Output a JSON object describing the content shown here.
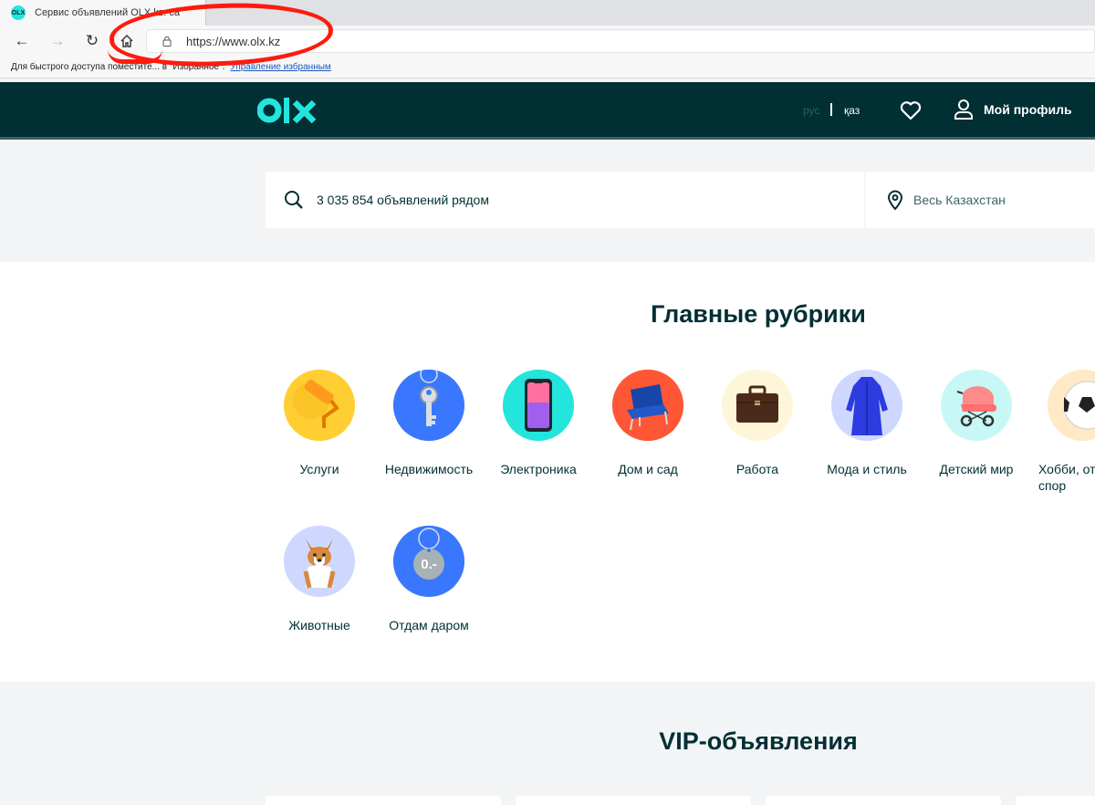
{
  "browser": {
    "tab_title": "Сервис объявлений OLX.kz: са",
    "favicon_text": "OLX",
    "url": "https://www.olx.kz",
    "favorites_bar_text": "Для быстрого доступа поместите... в \"Избранное\".",
    "favorites_manage_link": "Управление избранным"
  },
  "header": {
    "logo": "olx",
    "lang_ru": "рус",
    "lang_kz": "қаз",
    "profile_label": "Мой профиль",
    "colors": {
      "header_bg": "#002f34",
      "accent": "#23e5db"
    }
  },
  "search": {
    "placeholder": "3 035 854 объявлений рядом",
    "location": "Весь Казахстан"
  },
  "categories": {
    "title": "Главные рубрики",
    "items": [
      {
        "label": "Услуги",
        "icon": "paint-roller-icon",
        "bg": "#ffce32"
      },
      {
        "label": "Недвижимость",
        "icon": "key-icon",
        "bg": "#3a77ff"
      },
      {
        "label": "Электроника",
        "icon": "smartphone-icon",
        "bg": "#23e5db"
      },
      {
        "label": "Дом и сад",
        "icon": "armchair-icon",
        "bg": "#ff5636"
      },
      {
        "label": "Работа",
        "icon": "briefcase-icon",
        "bg": "#fff6d9"
      },
      {
        "label": "Мода и стиль",
        "icon": "dress-icon",
        "bg": "#ced8ff"
      },
      {
        "label": "Детский мир",
        "icon": "stroller-icon",
        "bg": "#c8f8f6"
      },
      {
        "label": "Хобби, отд спор",
        "icon": "ball-icon",
        "bg": "#ffe9c6"
      },
      {
        "label": "Животные",
        "icon": "dog-icon",
        "bg": "#ced8ff"
      },
      {
        "label": "Отдам даром",
        "icon": "price-tag-icon",
        "bg": "#3a77ff"
      }
    ]
  },
  "vip": {
    "title": "VIP-объявления"
  }
}
